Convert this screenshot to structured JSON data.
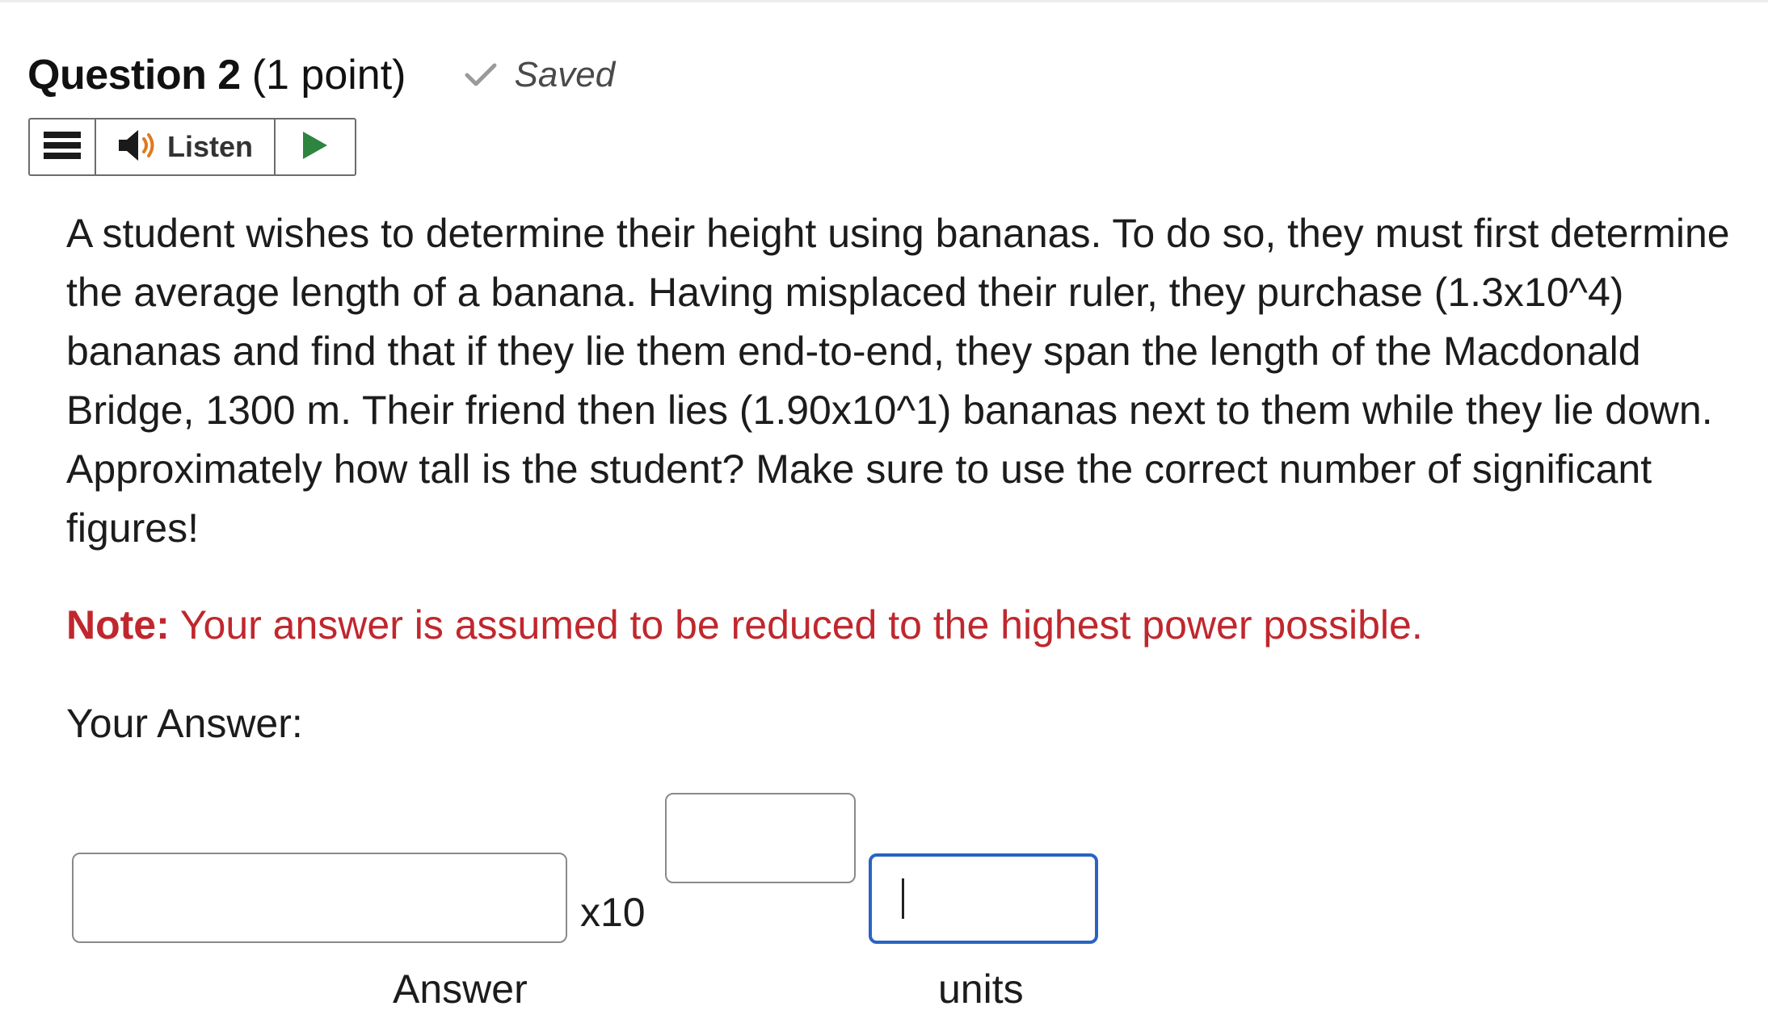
{
  "question": {
    "title": "Question 2",
    "points": "(1 point)",
    "status": "Saved"
  },
  "toolbar": {
    "menu_icon": "hamburger-menu-icon",
    "speaker_icon": "speaker-icon",
    "listen_label": "Listen",
    "play_icon": "play-icon",
    "play_color": "#2e8540"
  },
  "body": {
    "text": "A student wishes to determine their height using bananas. To do so, they must first determine the average length of a banana. Having misplaced their ruler, they purchase (1.3x10^4) bananas and find that if they lie them end-to-end, they span the length of the Macdonald Bridge, 1300 m. Their friend then lies (1.90x10^1) bananas next to them while they lie down. Approximately how tall is the student? Make sure to use the correct number of significant figures!",
    "note_label": "Note:",
    "note_text": " Your answer is assumed to be reduced to the highest power possible.",
    "note_color": "#c0272d",
    "your_answer_label": "Your Answer:"
  },
  "answer_form": {
    "answer_value": "",
    "times_ten": "x10",
    "exponent_value": "",
    "units_value": "",
    "answer_label": "Answer",
    "units_label": "units",
    "focus_color": "#2a63c2"
  }
}
